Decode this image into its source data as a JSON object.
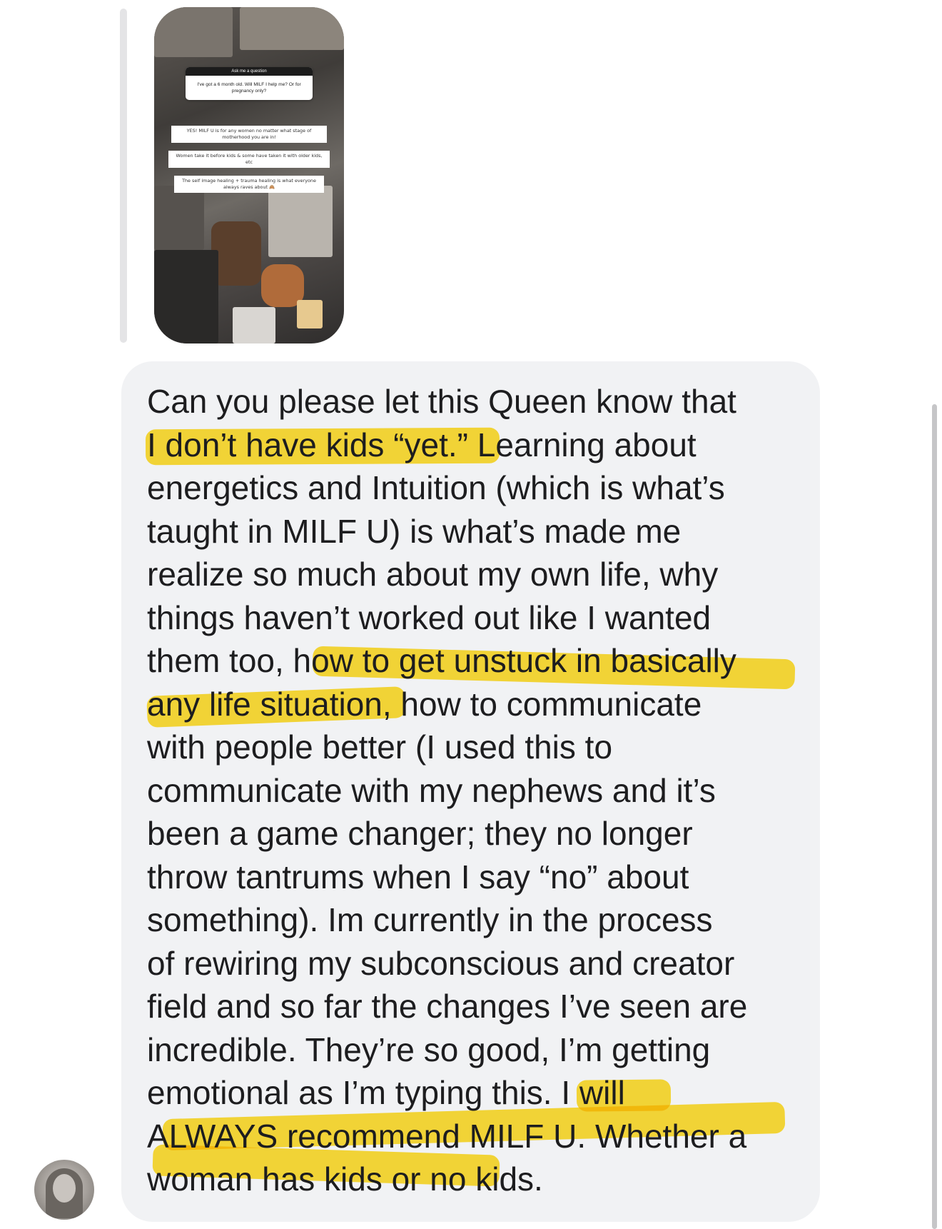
{
  "story_reply": {
    "question_header": "Ask me a question",
    "question_text": "I've got a 6 month old. Will MILF I help me? Or for pregnancy only?",
    "answers": [
      "YES! MILF U is for any women no matter what stage of motherhood you are in!",
      "Women take it before kids & some have taken it with older kids, etc",
      "The self image healing + trauma healing is what everyone always raves about 🙈"
    ]
  },
  "message": {
    "lines": [
      "Can you please let this Queen know that",
      "I don’t have kids “yet.” Learning about",
      "energetics and Intuition (which is what’s",
      "taught in MILF U) is what’s made me",
      "realize so much about my own life, why",
      "things haven’t worked out like I wanted",
      "them too, how to get unstuck in basically",
      "any life situation, how to communicate",
      "with people better (I used this to",
      "communicate with my nephews and it’s",
      "been a game changer; they no longer",
      "throw tantrums when I say “no” about",
      "something). Im currently in the process",
      "of rewiring my subconscious and creator",
      "field and so far the changes I’ve seen are",
      "incredible. They’re so good, I’m getting",
      "emotional as I’m typing this. I will",
      "ALWAYS recommend MILF U. Whether a",
      "woman has kids or no kids."
    ],
    "highlight_color": "#FFD600"
  },
  "colors": {
    "bubble": "#F1F2F4",
    "text": "#1D1D1F",
    "reply_bar": "#E4E4E6"
  }
}
